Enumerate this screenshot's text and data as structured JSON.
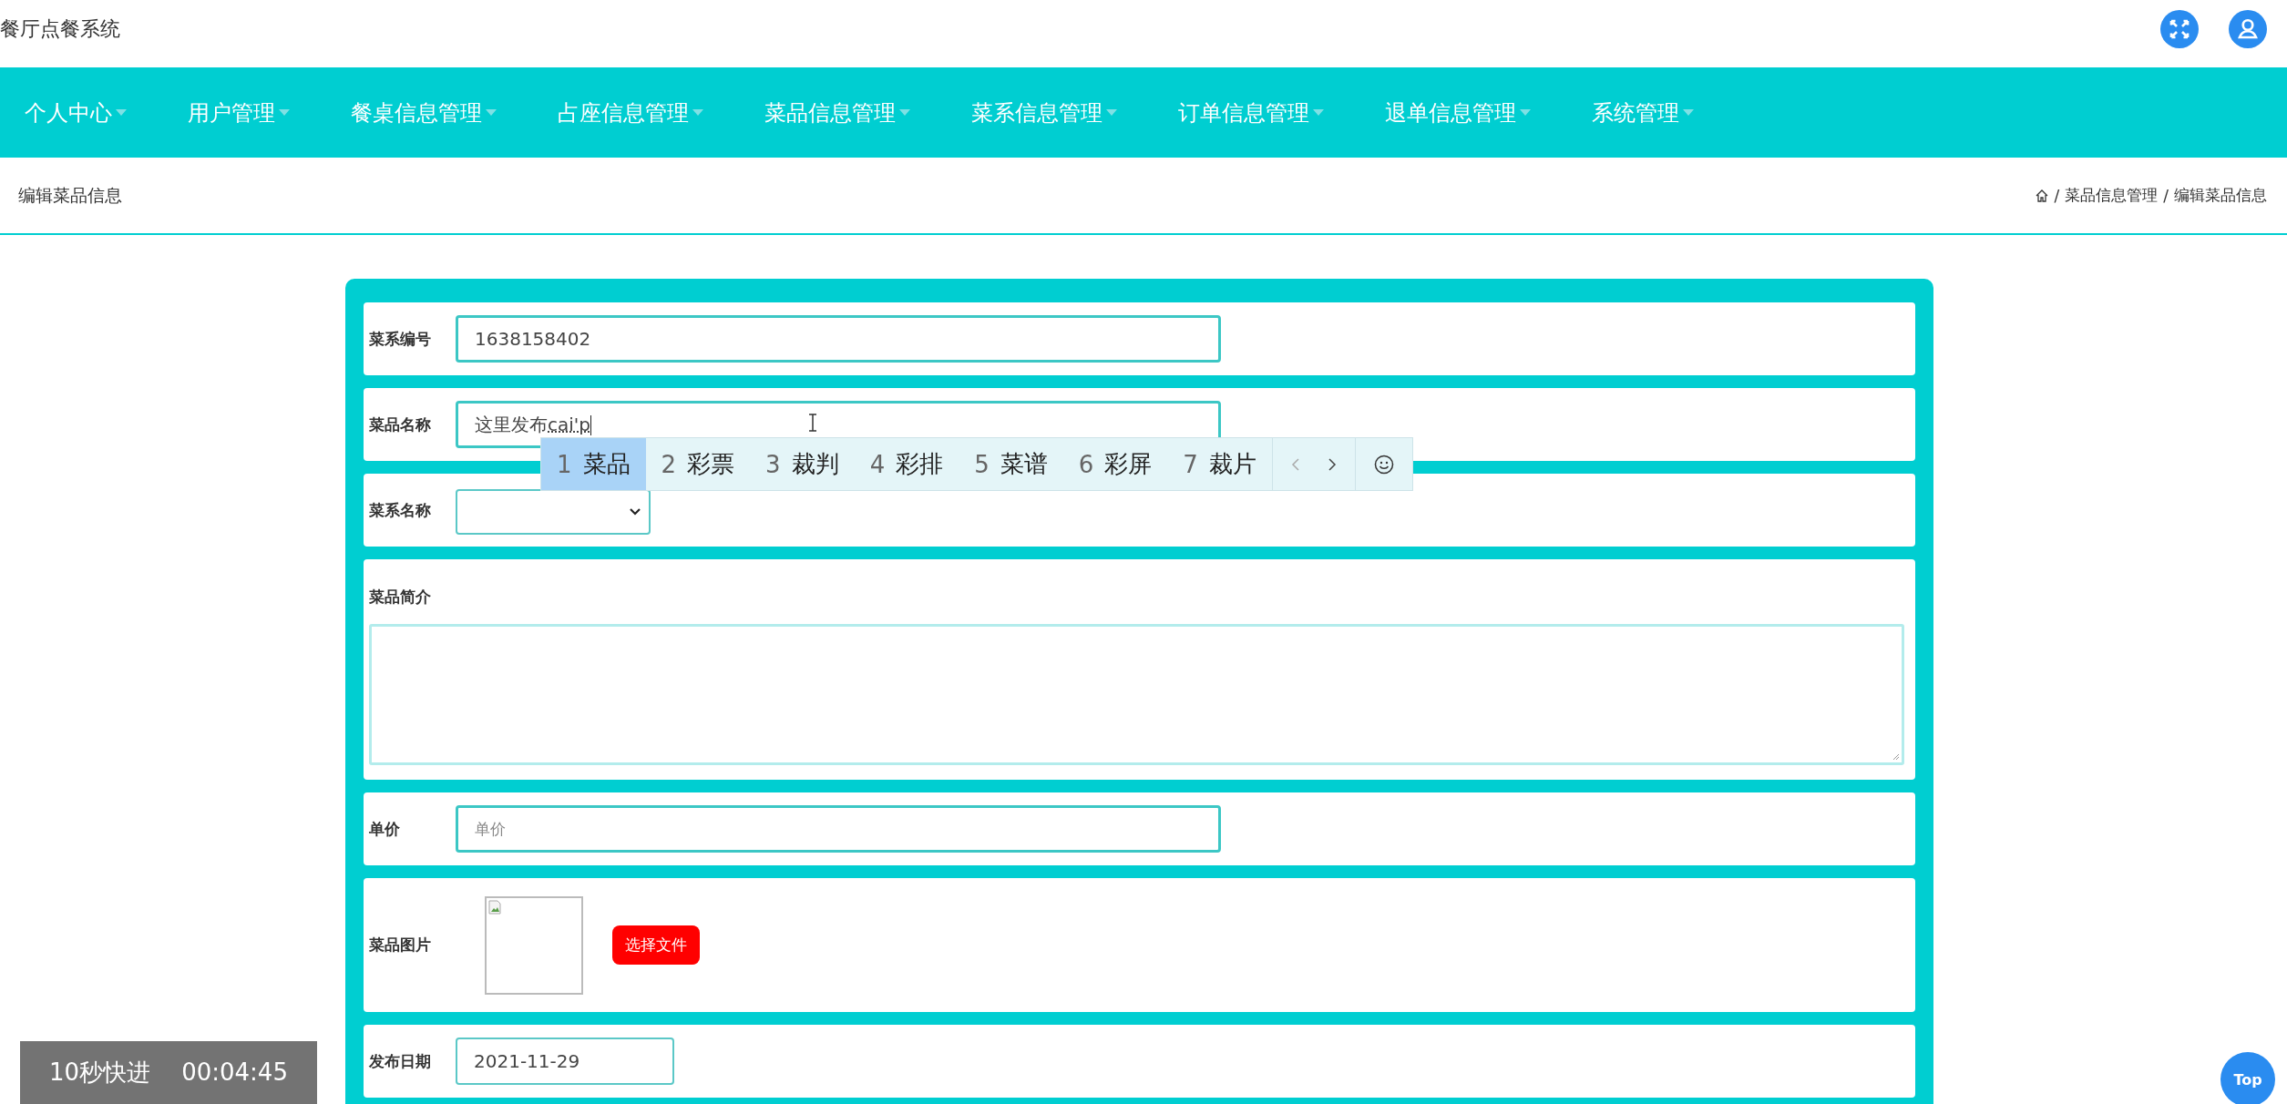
{
  "header": {
    "title": "餐厅点餐系统"
  },
  "nav": {
    "items": [
      {
        "label": "个人中心"
      },
      {
        "label": "用户管理"
      },
      {
        "label": "餐桌信息管理"
      },
      {
        "label": "占座信息管理"
      },
      {
        "label": "菜品信息管理"
      },
      {
        "label": "菜系信息管理"
      },
      {
        "label": "订单信息管理"
      },
      {
        "label": "退单信息管理"
      },
      {
        "label": "系统管理"
      }
    ]
  },
  "breadcrumb": {
    "page_title": "编辑菜品信息",
    "separator": "/",
    "trail": [
      "菜品信息管理",
      "编辑菜品信息"
    ]
  },
  "form": {
    "fields": [
      {
        "kind": "text",
        "label": "菜系编号",
        "value": "1638158402"
      },
      {
        "kind": "text",
        "label": "菜品名称",
        "value": "这里发布",
        "composition": "cai'p"
      },
      {
        "kind": "select",
        "label": "菜系名称"
      },
      {
        "kind": "textarea",
        "label": "菜品简介"
      },
      {
        "kind": "text",
        "label": "单价",
        "placeholder": "单价"
      },
      {
        "kind": "image",
        "label": "菜品图片",
        "button": "选择文件"
      },
      {
        "kind": "date",
        "label": "发布日期",
        "value": "2021-11-29"
      }
    ]
  },
  "ime": {
    "candidates": [
      {
        "index": "1",
        "text": "菜品",
        "selected": true
      },
      {
        "index": "2",
        "text": "彩票",
        "selected": false
      },
      {
        "index": "3",
        "text": "裁判",
        "selected": false
      },
      {
        "index": "4",
        "text": "彩排",
        "selected": false
      },
      {
        "index": "5",
        "text": "菜谱",
        "selected": false
      },
      {
        "index": "6",
        "text": "彩屏",
        "selected": false
      },
      {
        "index": "7",
        "text": "裁片",
        "selected": false
      }
    ]
  },
  "video_overlay": {
    "label": "10秒快进",
    "time": "00:04:45"
  },
  "back_to_top": {
    "label": "Top"
  }
}
